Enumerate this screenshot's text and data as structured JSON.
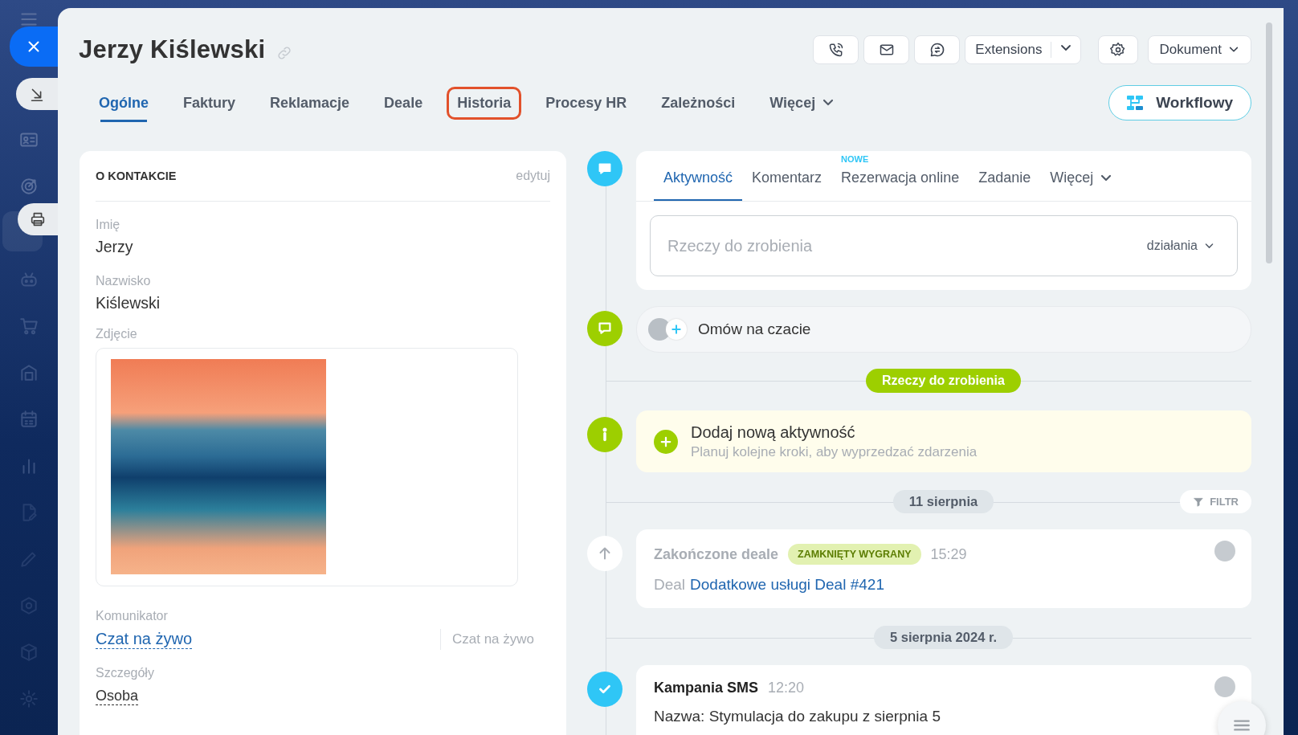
{
  "header": {
    "title": "Jerzy Kiślewski",
    "extensions": "Extensions",
    "document": "Dokument"
  },
  "tabs": [
    {
      "label": "Ogólne",
      "selected": true,
      "highlighted": false,
      "kind": "tab"
    },
    {
      "label": "Faktury",
      "selected": false,
      "highlighted": false,
      "kind": "tab"
    },
    {
      "label": "Reklamacje",
      "selected": false,
      "highlighted": false,
      "kind": "tab"
    },
    {
      "label": "Deale",
      "selected": false,
      "highlighted": false,
      "kind": "tab"
    },
    {
      "label": "Historia",
      "selected": false,
      "highlighted": true,
      "kind": "tab"
    },
    {
      "label": "Procesy HR",
      "selected": false,
      "highlighted": false,
      "kind": "tab"
    },
    {
      "label": "Zależności",
      "selected": false,
      "highlighted": false,
      "kind": "tab"
    },
    {
      "label": "Więcej",
      "selected": false,
      "highlighted": false,
      "kind": "dropdown"
    }
  ],
  "workflow_button": "Workflowy",
  "contact": {
    "heading": "O KONTAKCIE",
    "edit": "edytuj",
    "fields": [
      {
        "kind": "text",
        "label": "Imię",
        "value": "Jerzy"
      },
      {
        "kind": "text",
        "label": "Nazwisko",
        "value": "Kiślewski"
      },
      {
        "kind": "photo",
        "label": "Zdjęcie"
      },
      {
        "kind": "link",
        "label": "Komunikator",
        "value": "Czat na żywo",
        "secondary": "Czat na żywo"
      },
      {
        "kind": "underlined",
        "label": "Szczegóły",
        "value": "Osoba"
      }
    ]
  },
  "timeline": [
    {
      "kind": "composer",
      "tabs": [
        {
          "kind": "tab",
          "label": "Aktywność",
          "selected": true
        },
        {
          "kind": "tab",
          "label": "Komentarz",
          "selected": false
        },
        {
          "kind": "tab",
          "label": "Rezerwacja online",
          "selected": false,
          "badge": "NOWE"
        },
        {
          "kind": "tab",
          "label": "Zadanie",
          "selected": false
        },
        {
          "kind": "dropdown",
          "label": "Więcej",
          "selected": false
        }
      ],
      "placeholder": "Rzeczy do zrobienia",
      "actions": "działania"
    },
    {
      "kind": "chat",
      "text": "Omów na czacie"
    },
    {
      "kind": "section",
      "text": "Rzeczy do zrobienia"
    },
    {
      "kind": "add",
      "title": "Dodaj nową aktywność",
      "subtitle": "Planuj kolejne kroki, aby wyprzedzać zdarzenia"
    },
    {
      "kind": "date",
      "text": "11 sierpnia",
      "filter": "FILTR"
    },
    {
      "kind": "deal",
      "title": "Zakończone deale",
      "status": "ZAMKNIĘTY WYGRANY",
      "time": "15:29",
      "label": "Deal",
      "link": "Dodatkowe usługi Deal #421"
    },
    {
      "kind": "date",
      "text": "5 sierpnia 2024 r."
    },
    {
      "kind": "sms",
      "title": "Kampania SMS",
      "time": "12:20",
      "text": "Nazwa: Stymulacja do zakupu z sierpnia 5"
    }
  ]
}
